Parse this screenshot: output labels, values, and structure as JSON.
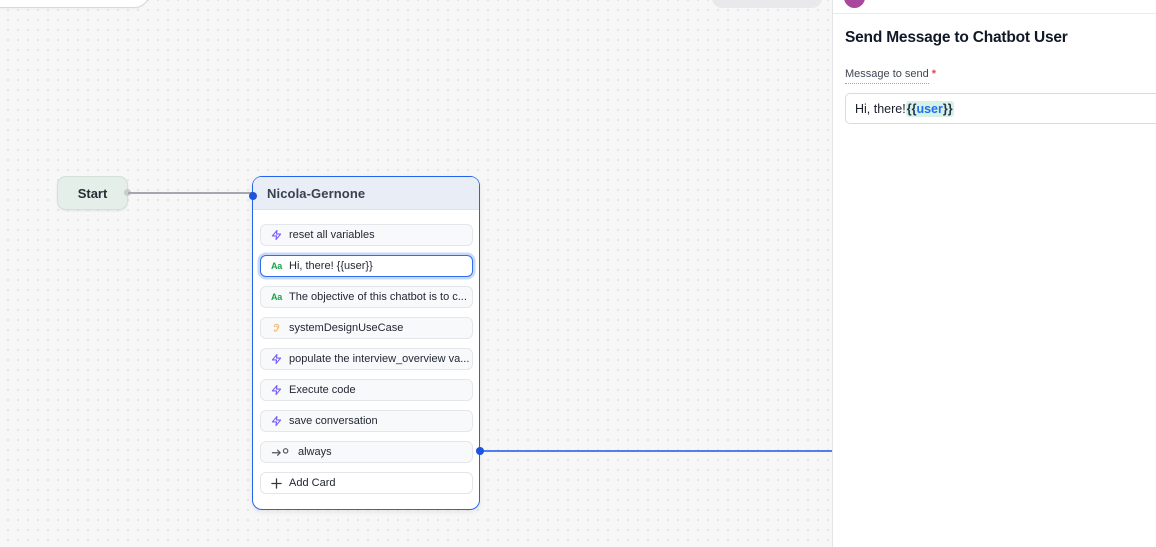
{
  "canvas": {
    "start_node": {
      "label": "Start"
    },
    "workflow_node": {
      "title": "Nicola-Gernone",
      "cards": [
        {
          "icon": "zap-icon",
          "label": "reset all variables"
        },
        {
          "icon": "text-icon",
          "icon_text": "Aa",
          "label": "Hi, there! {{user}}",
          "selected": true
        },
        {
          "icon": "text-icon",
          "icon_text": "Aa",
          "label": "The objective of this chatbot is to c..."
        },
        {
          "icon": "ear-icon",
          "label": "systemDesignUseCase"
        },
        {
          "icon": "zap-icon",
          "label": "populate the interview_overview va..."
        },
        {
          "icon": "zap-icon",
          "label": "Execute code"
        },
        {
          "icon": "zap-icon",
          "label": "save conversation"
        },
        {
          "icon": "transition-icon",
          "label": "always"
        }
      ],
      "add_card": {
        "icon": "plus-icon",
        "label": "Add Card"
      }
    }
  },
  "panel": {
    "title": "Send Message to Chatbot User",
    "field": {
      "label": "Message to send",
      "required_marker": "*",
      "value_before": "Hi, there! ",
      "variable_open": "{{",
      "variable_name": "user",
      "variable_close": "}}"
    }
  },
  "colors": {
    "node_border_blue": "#2563eb",
    "wire_blue": "#507ef2",
    "port_blue": "#1d53dd",
    "header_bg": "#e9edf5",
    "start_node_bg": "#e3efe8",
    "zap_icon": "#7a5af8",
    "text_icon_green": "#1da14c",
    "ear_icon": "#f0b269",
    "variable_highlight": "#d7f2e4",
    "variable_text": "#1d6ff2",
    "avatar_purple": "#a8479d",
    "required_red": "#e5484d"
  }
}
